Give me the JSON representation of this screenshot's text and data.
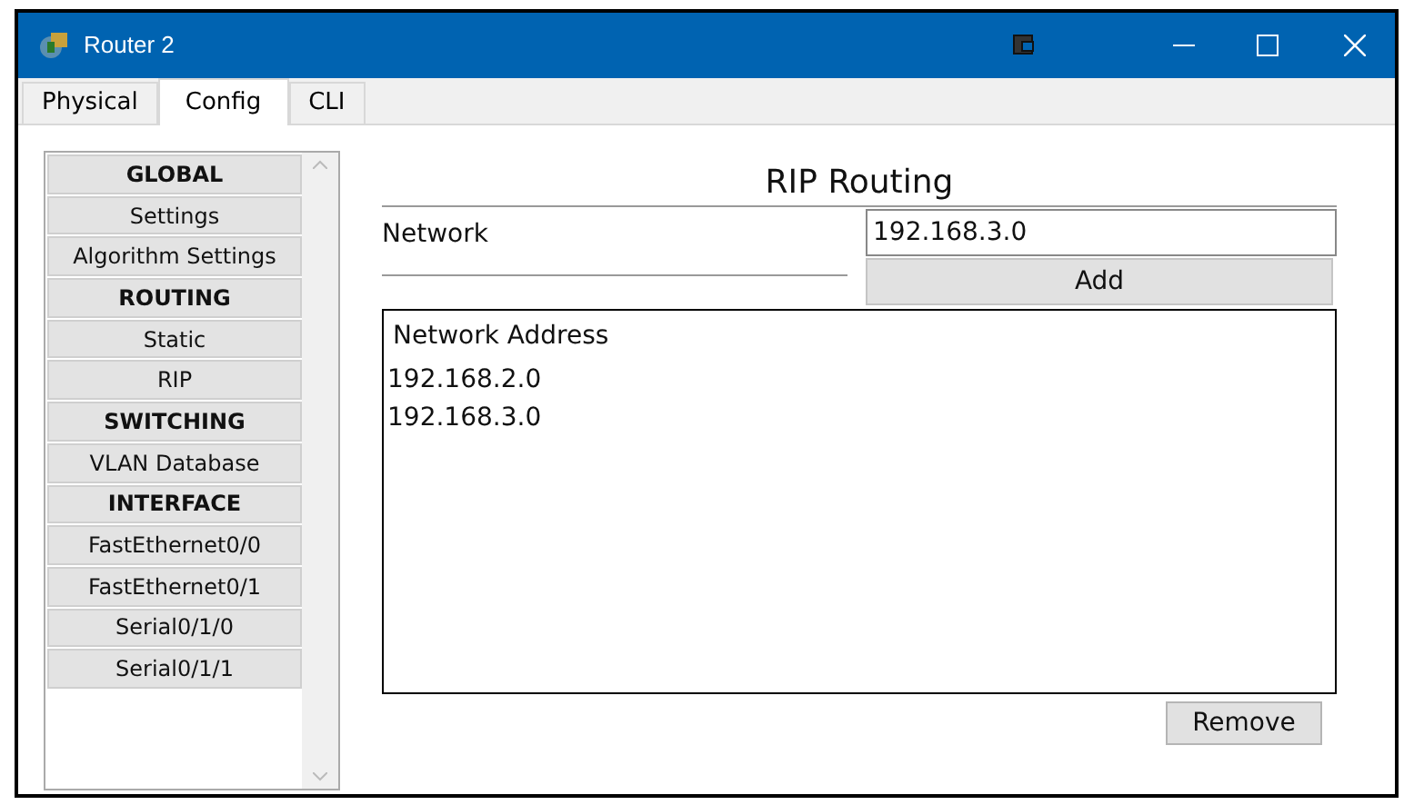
{
  "window": {
    "title": "Router 2"
  },
  "tabs": [
    {
      "label": "Physical",
      "selected": false
    },
    {
      "label": "Config",
      "selected": true
    },
    {
      "label": "CLI",
      "selected": false
    }
  ],
  "sidebar": {
    "items": [
      {
        "label": "GLOBAL",
        "kind": "header"
      },
      {
        "label": "Settings",
        "kind": "item"
      },
      {
        "label": "Algorithm Settings",
        "kind": "item"
      },
      {
        "label": "ROUTING",
        "kind": "header"
      },
      {
        "label": "Static",
        "kind": "item"
      },
      {
        "label": "RIP",
        "kind": "item"
      },
      {
        "label": "SWITCHING",
        "kind": "header"
      },
      {
        "label": "VLAN Database",
        "kind": "item"
      },
      {
        "label": "INTERFACE",
        "kind": "header"
      },
      {
        "label": "FastEthernet0/0",
        "kind": "item"
      },
      {
        "label": "FastEthernet0/1",
        "kind": "item"
      },
      {
        "label": "Serial0/1/0",
        "kind": "item"
      },
      {
        "label": "Serial0/1/1",
        "kind": "item"
      }
    ]
  },
  "panel": {
    "title": "RIP Routing",
    "network_label": "Network",
    "network_value": "192.168.3.0",
    "add_button": "Add",
    "list": {
      "header": "Network Address",
      "rows": [
        "192.168.2.0",
        "192.168.3.0"
      ]
    },
    "remove_button": "Remove"
  }
}
